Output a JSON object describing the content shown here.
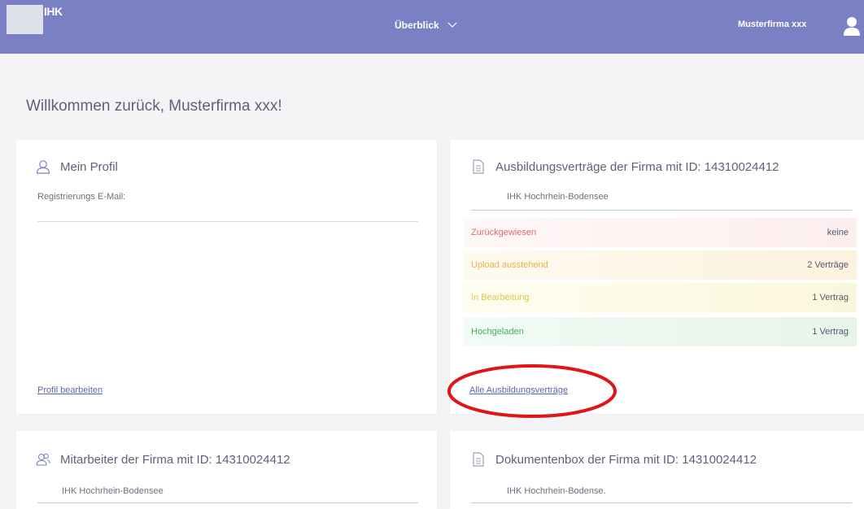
{
  "header": {
    "logo_text": "IHK",
    "nav_label": "Überblick",
    "user_name": "Musterfirma xxx"
  },
  "welcome": "Willkommen zurück, Musterfirma xxx!",
  "profile": {
    "title": "Mein Profil",
    "reg_email_label": "Registrierungs E-Mail:",
    "edit_link": "Profil bearbeiten"
  },
  "contracts": {
    "title": "Ausbildungsverträge der Firma mit ID: 14310024412",
    "organization": "IHK Hochrhein-Bodensee",
    "statuses": [
      {
        "label": "Zurückgewiesen",
        "count": "keine",
        "color": "#e16a6a"
      },
      {
        "label": "Upload ausstehend",
        "count": "2 Verträge",
        "color": "#e7b14a"
      },
      {
        "label": "In Bearbeitung",
        "count": "1 Vertrag",
        "color": "#e2c34c"
      },
      {
        "label": "Hochgeladen",
        "count": "1 Vertrag",
        "color": "#3fae62"
      }
    ],
    "all_link": "Alle Ausbildungsverträge"
  },
  "employees": {
    "title": "Mitarbeiter der Firma mit ID: 14310024412",
    "organization": "IHK Hochrhein-Bodensee"
  },
  "documents": {
    "title": "Dokumentenbox der Firma mit ID: 14310024412",
    "organization": "IHK Hochrhein-Bodense."
  },
  "colors": {
    "header_bg": "#7b7fc4",
    "link": "#5a66b0",
    "highlight": "#e01515"
  }
}
